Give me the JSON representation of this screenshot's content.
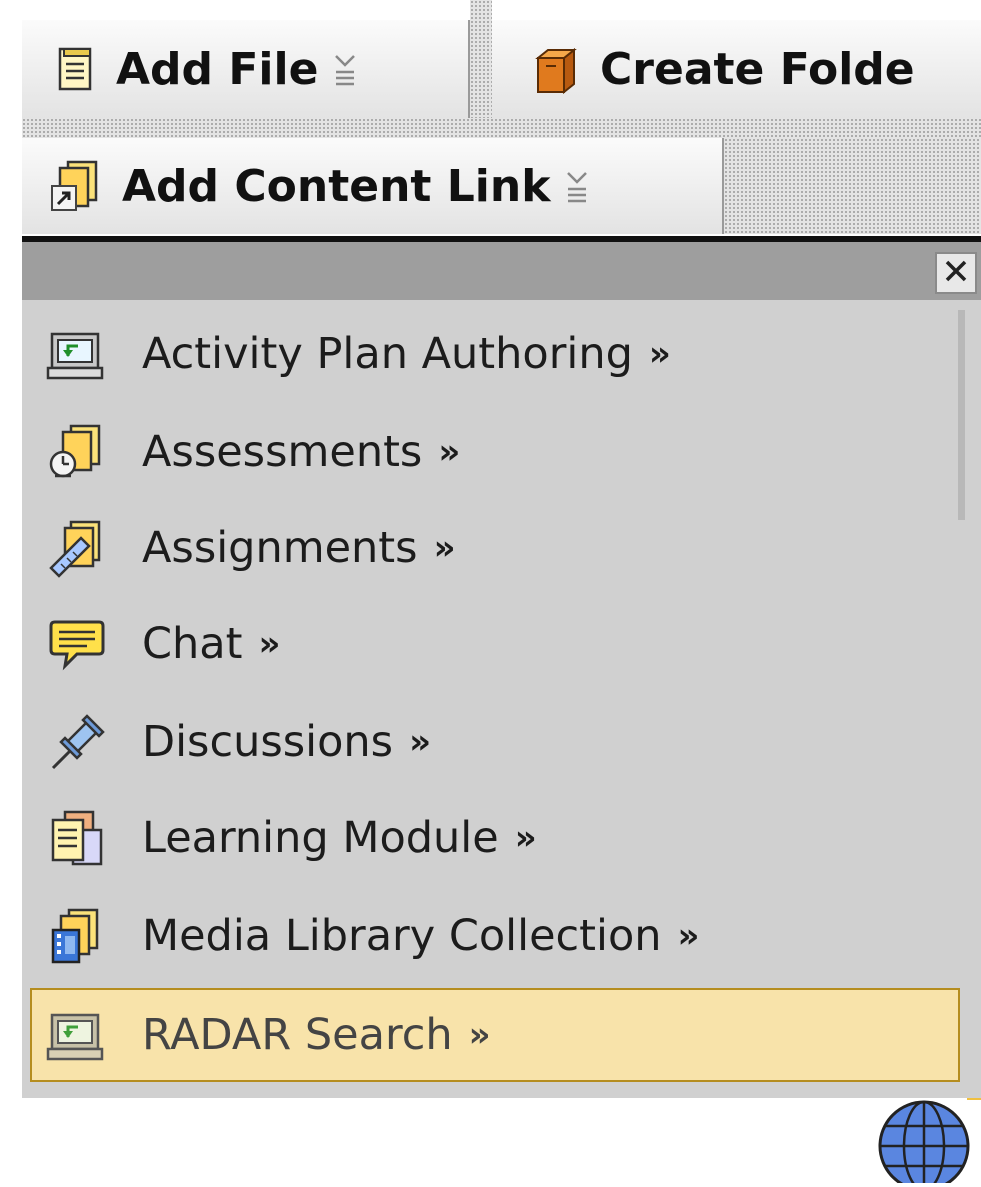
{
  "toolbar": {
    "add_file_label": "Add File",
    "create_folder_label": "Create Folde",
    "add_content_link_label": "Add Content Link"
  },
  "menu": {
    "close_icon": "close-icon",
    "items": [
      {
        "label": "Activity Plan Authoring",
        "chevron": "»",
        "icon": "computer-icon"
      },
      {
        "label": "Assessments",
        "chevron": "»",
        "icon": "assessment-icon"
      },
      {
        "label": "Assignments",
        "chevron": "»",
        "icon": "assignment-icon"
      },
      {
        "label": "Chat",
        "chevron": "»",
        "icon": "chat-icon"
      },
      {
        "label": "Discussions",
        "chevron": "»",
        "icon": "pushpin-icon"
      },
      {
        "label": "Learning Module",
        "chevron": "»",
        "icon": "learning-module-icon"
      },
      {
        "label": "Media Library Collection",
        "chevron": "»",
        "icon": "media-library-icon"
      },
      {
        "label": "RADAR Search",
        "chevron": "»",
        "icon": "computer-icon",
        "selected": true
      }
    ]
  },
  "colors": {
    "menu_bg": "#d0d0d0",
    "menu_header": "#9e9e9e",
    "selected_bg": "#f8e3aa",
    "selected_border": "#b58d1f"
  }
}
